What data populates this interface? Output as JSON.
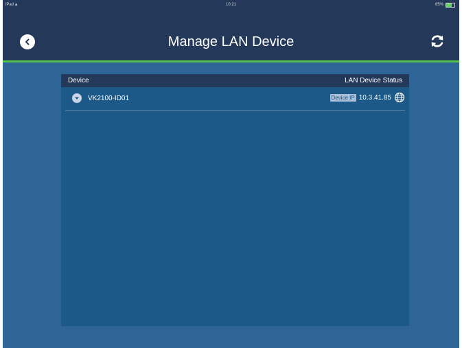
{
  "status_bar": {
    "left": "iPad",
    "time": "10:21",
    "battery_text": "65%",
    "battery_level": 0.65
  },
  "header": {
    "title": "Manage LAN Device"
  },
  "table": {
    "columns": {
      "device": "Device",
      "status": "LAN Device Status"
    },
    "rows": [
      {
        "name": "VK2100-ID01",
        "ip_label": "Device IP",
        "ip": "10.3.41.85"
      }
    ]
  },
  "colors": {
    "background": "#2f6596",
    "topbar": "#24385a",
    "accent": "#56c44a"
  },
  "icons": {
    "back": "back-arrow-icon",
    "refresh": "refresh-icon",
    "expand": "chevron-down-icon",
    "network": "globe-icon"
  }
}
